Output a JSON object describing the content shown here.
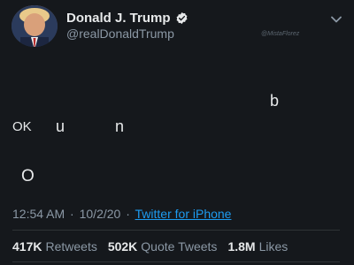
{
  "author": {
    "display_name": "Donald J. Trump",
    "handle": "@realDonaldTrump",
    "verified": true,
    "avatar_icon": "profile-photo"
  },
  "watermark": "@MistaFlorez",
  "menu_icon": "chevron-down-icon",
  "body": {
    "b": "b",
    "ok": "OK",
    "u": "u",
    "n": "n",
    "o": "O"
  },
  "meta": {
    "time": "12:54 AM",
    "separator": "·",
    "date": "10/2/20",
    "source": "Twitter for iPhone"
  },
  "stats": {
    "retweets_count": "417K",
    "retweets_label": "Retweets",
    "quote_count": "502K",
    "quote_label": "Quote Tweets",
    "likes_count": "1.8M",
    "likes_label": "Likes"
  },
  "colors": {
    "background": "#15181c",
    "link": "#1d9bf0",
    "secondary_text": "#8b98a5"
  }
}
